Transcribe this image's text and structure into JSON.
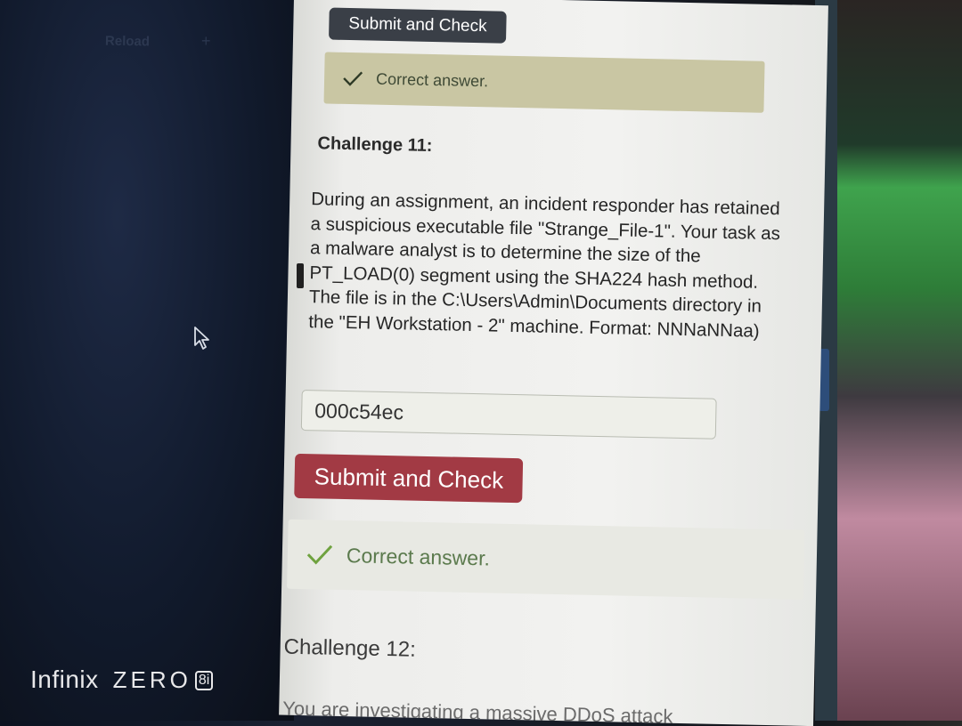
{
  "browser": {
    "reload_label": "Reload",
    "plus_label": "+"
  },
  "device_brand": {
    "name": "Infinix",
    "model": "ZERO",
    "badge": "8i"
  },
  "top_section": {
    "submit_label": "Submit and Check",
    "feedback": "Correct answer."
  },
  "challenge11": {
    "title": "Challenge 11:",
    "question": "During an assignment, an incident responder has retained a suspicious executable file \"Strange_File-1\". Your task as a malware analyst is to determine the size of the PT_LOAD(0) segment using the SHA224 hash method. The file is in the C:\\Users\\Admin\\Documents directory in the \"EH Workstation - 2\" machine. Format: NNNaNNaa)",
    "answer_value": "000c54ec",
    "submit_label": "Submit and Check",
    "feedback": "Correct answer."
  },
  "challenge12": {
    "title": "Challenge 12:",
    "question_partial": "You are investigating a massive DDoS attack"
  },
  "colors": {
    "submit_dark": "#3a3f47",
    "submit_red": "#a23a44",
    "success_green": "#6fa23f",
    "alert_top_bg": "#c9c6a3",
    "alert_bottom_bg": "#e8e9e3"
  },
  "icons": {
    "check": "check-icon",
    "cursor": "mouse-pointer-icon"
  }
}
